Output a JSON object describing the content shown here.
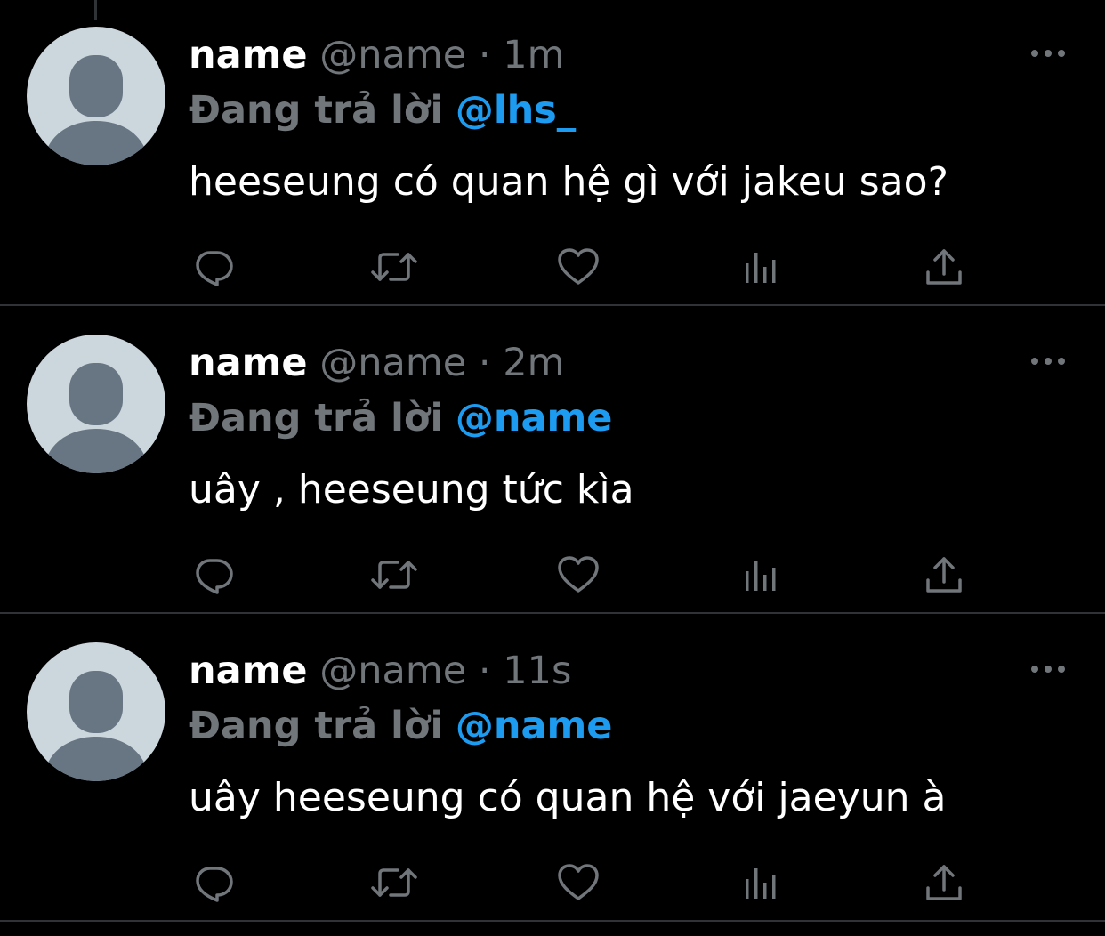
{
  "tweets": [
    {
      "display_name": "name",
      "handle": "@name",
      "separator": "·",
      "time": "1m",
      "reply_prefix": "Đang trả lời",
      "reply_to": "@lhs_",
      "text": "heeseung có quan hệ gì với jakeu sao?"
    },
    {
      "display_name": "name",
      "handle": "@name",
      "separator": "·",
      "time": "2m",
      "reply_prefix": "Đang trả lời",
      "reply_to": "@name",
      "text": "uây , heeseung tức kìa"
    },
    {
      "display_name": "name",
      "handle": "@name",
      "separator": "·",
      "time": "11s",
      "reply_prefix": "Đang trả lời",
      "reply_to": "@name",
      "text": "uây heeseung có quan hệ với jaeyun à"
    }
  ],
  "icons": {
    "more": "more-horizontal-icon",
    "reply": "reply-bubble-icon",
    "retweet": "retweet-icon",
    "like": "heart-icon",
    "analytics": "analytics-bars-icon",
    "share": "share-upload-icon"
  },
  "colors": {
    "background": "#000000",
    "text_primary": "#ffffff",
    "text_secondary": "#71767b",
    "accent": "#1d9bf0",
    "divider": "#2f3336",
    "avatar_bg": "#ccd6dd",
    "avatar_fg": "#687684"
  }
}
